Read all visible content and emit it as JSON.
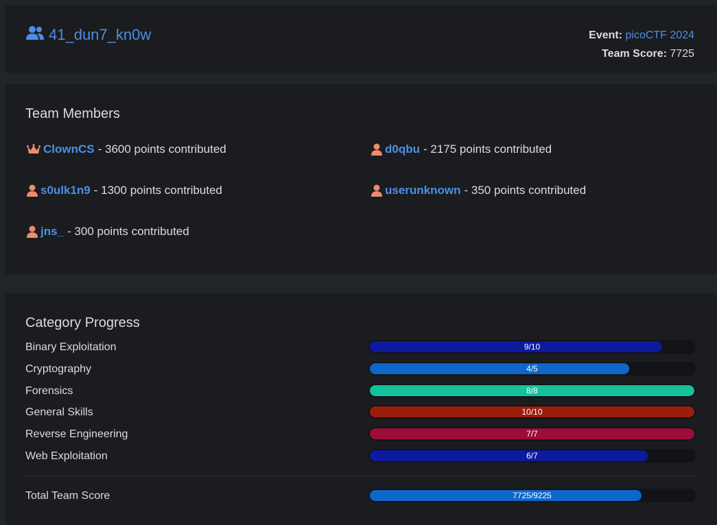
{
  "team": {
    "name": "41_dun7_kn0w",
    "event_label": "Event:",
    "event_name": "picoCTF 2024",
    "score_label": "Team Score:",
    "score_value": "7725"
  },
  "members_section": {
    "title": "Team Members",
    "members": [
      {
        "name": "ClownCS",
        "points": "- 3600 points contributed",
        "role_icon": "crown-icon"
      },
      {
        "name": "d0qbu",
        "points": "- 2175 points contributed",
        "role_icon": "user-icon"
      },
      {
        "name": "s0ulk1n9",
        "points": "- 1300 points contributed",
        "role_icon": "user-icon"
      },
      {
        "name": "userunknown",
        "points": "- 350 points contributed",
        "role_icon": "user-icon"
      },
      {
        "name": "jns_",
        "points": "- 300 points contributed",
        "role_icon": "user-icon"
      }
    ]
  },
  "progress_section": {
    "title": "Category Progress",
    "categories": [
      {
        "name": "Binary Exploitation",
        "label": "9/10",
        "fraction": 0.9,
        "color": "#0d1a9e"
      },
      {
        "name": "Cryptography",
        "label": "4/5",
        "fraction": 0.8,
        "color": "#0e66c8"
      },
      {
        "name": "Forensics",
        "label": "8/8",
        "fraction": 1.0,
        "color": "#12c29b"
      },
      {
        "name": "General Skills",
        "label": "10/10",
        "fraction": 1.0,
        "color": "#9b1d0c"
      },
      {
        "name": "Reverse Engineering",
        "label": "7/7",
        "fraction": 1.0,
        "color": "#9c0d3a"
      },
      {
        "name": "Web Exploitation",
        "label": "6/7",
        "fraction": 0.857,
        "color": "#0d1a9e"
      }
    ],
    "total": {
      "name": "Total Team Score",
      "label": "7725/9225",
      "fraction": 0.837,
      "color": "#0e66c8"
    }
  },
  "colors": {
    "accent": "#4c8fe6",
    "member_icon": "#f08a6c",
    "background": "#212528",
    "card": "#1a1c1f"
  }
}
